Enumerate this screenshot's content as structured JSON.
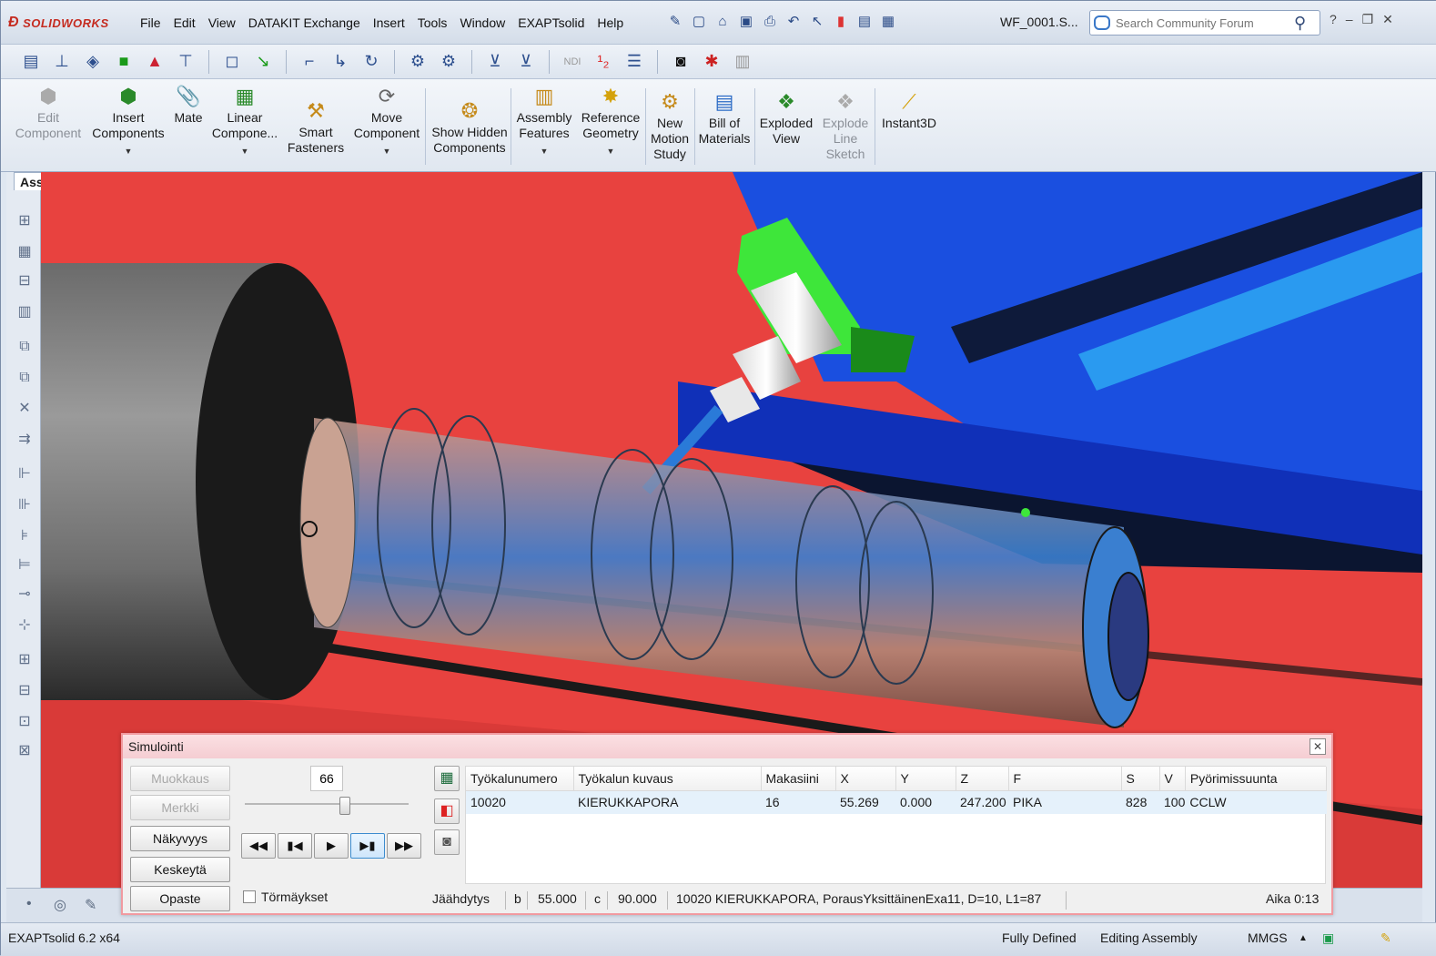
{
  "app": {
    "brand": "SOLIDWORKS",
    "document_title": "WF_0001.S..."
  },
  "menu": [
    "File",
    "Edit",
    "View",
    "DATAKIT Exchange",
    "Insert",
    "Tools",
    "Window",
    "EXAPTsolid",
    "Help"
  ],
  "search": {
    "placeholder": "Search Community Forum"
  },
  "command_manager": {
    "edit_component": "Edit Component",
    "insert_components": "Insert Components",
    "mate": "Mate",
    "linear_component": "Linear Compone...",
    "smart_fasteners": "Smart Fasteners",
    "move_component": "Move Component",
    "show_hidden": "Show Hidden Components",
    "assembly_features": "Assembly Features",
    "reference_geometry": "Reference Geometry",
    "new_motion_study": "New Motion Study",
    "bill_of_materials": "Bill of Materials",
    "exploded_view": "Exploded View",
    "explode_line_sketch": "Explode Line Sketch",
    "instant3d": "Instant3D"
  },
  "left_panel": {
    "tab": "Assembly"
  },
  "simulation": {
    "title": "Simulointi",
    "buttons": {
      "muokkaus": "Muokkaus",
      "merkki": "Merkki",
      "nakyvyys": "Näkyvyys",
      "keskeyta": "Keskeytä",
      "opaste": "Opaste"
    },
    "speed_value": "66",
    "speed_slider_fraction": 0.62,
    "collisions_label": "Törmäykset",
    "columns": {
      "tool_number": "Työkalunumero",
      "tool_description": "Työkalun kuvaus",
      "magazine": "Makasiini",
      "x": "X",
      "y": "Y",
      "z": "Z",
      "f": "F",
      "s": "S",
      "v": "V",
      "rotation": "Pyörimissuunta"
    },
    "row": {
      "tool_number": "10020",
      "tool_description": "KIERUKKAPORA",
      "magazine": "16",
      "x": "55.269",
      "y": "0.000",
      "z": "247.200",
      "f": "PIKA",
      "s": "828",
      "v": "100",
      "rotation": "CCLW"
    },
    "info": {
      "coolant": "Jäähdytys",
      "b_label": "b",
      "b_value": "55.000",
      "c_label": "c",
      "c_value": "90.000",
      "operation": "10020 KIERUKKAPORA, PorausYksittäinenExa11, D=10, L1=87",
      "time": "Aika 0:13"
    }
  },
  "status": {
    "version": "EXAPTsolid 6.2 x64",
    "state": "Fully Defined",
    "mode": "Editing Assembly",
    "units": "MMGS"
  },
  "colors": {
    "background_red": "#e8423f",
    "machine_blue": "#1a4fe0",
    "holder_green": "#3ee63a",
    "dialog_border": "#f19aa0"
  }
}
